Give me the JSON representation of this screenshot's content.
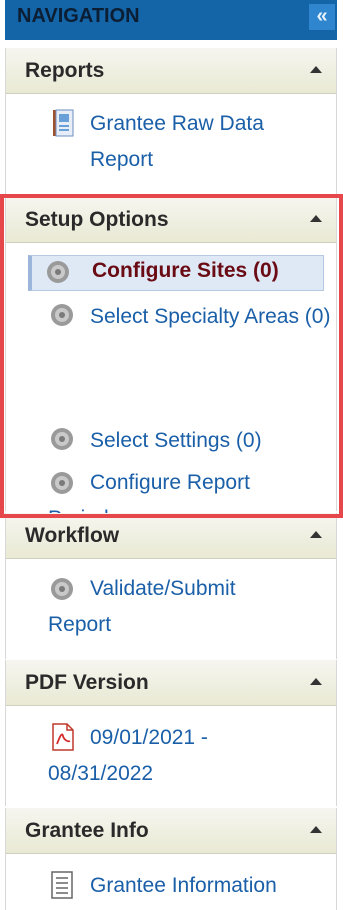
{
  "nav": {
    "title": "NAVIGATION",
    "collapse_icon": "double-chevron-left-icon",
    "collapse_glyph": "«"
  },
  "sections": {
    "reports": {
      "title": "Reports",
      "items": [
        {
          "label": "Grantee Raw Data Report",
          "icon": "report-book-icon"
        }
      ]
    },
    "setup": {
      "title": "Setup Options",
      "items": [
        {
          "label": "Configure Sites (0)",
          "icon": "gear-icon",
          "selected": true
        },
        {
          "label": "Select Specialty Areas (0)",
          "icon": "gear-icon"
        },
        {
          "label": "Select Settings (0)",
          "icon": "gear-icon"
        },
        {
          "label": "Configure Report Period:",
          "icon": "gear-icon"
        }
      ]
    },
    "workflow": {
      "title": "Workflow",
      "items": [
        {
          "label": "Validate/Submit Report",
          "icon": "gear-icon"
        }
      ]
    },
    "pdf": {
      "title": "PDF Version",
      "items": [
        {
          "label": "09/01/2021 - 08/31/2022",
          "icon": "pdf-icon"
        }
      ]
    },
    "grantee": {
      "title": "Grantee Info",
      "items": [
        {
          "label": "Grantee Information",
          "icon": "document-icon"
        }
      ]
    }
  },
  "colors": {
    "header_bg": "#1464a8",
    "link": "#1a5fa8",
    "selected_text": "#6a0b14",
    "highlight": "#e6474a"
  }
}
